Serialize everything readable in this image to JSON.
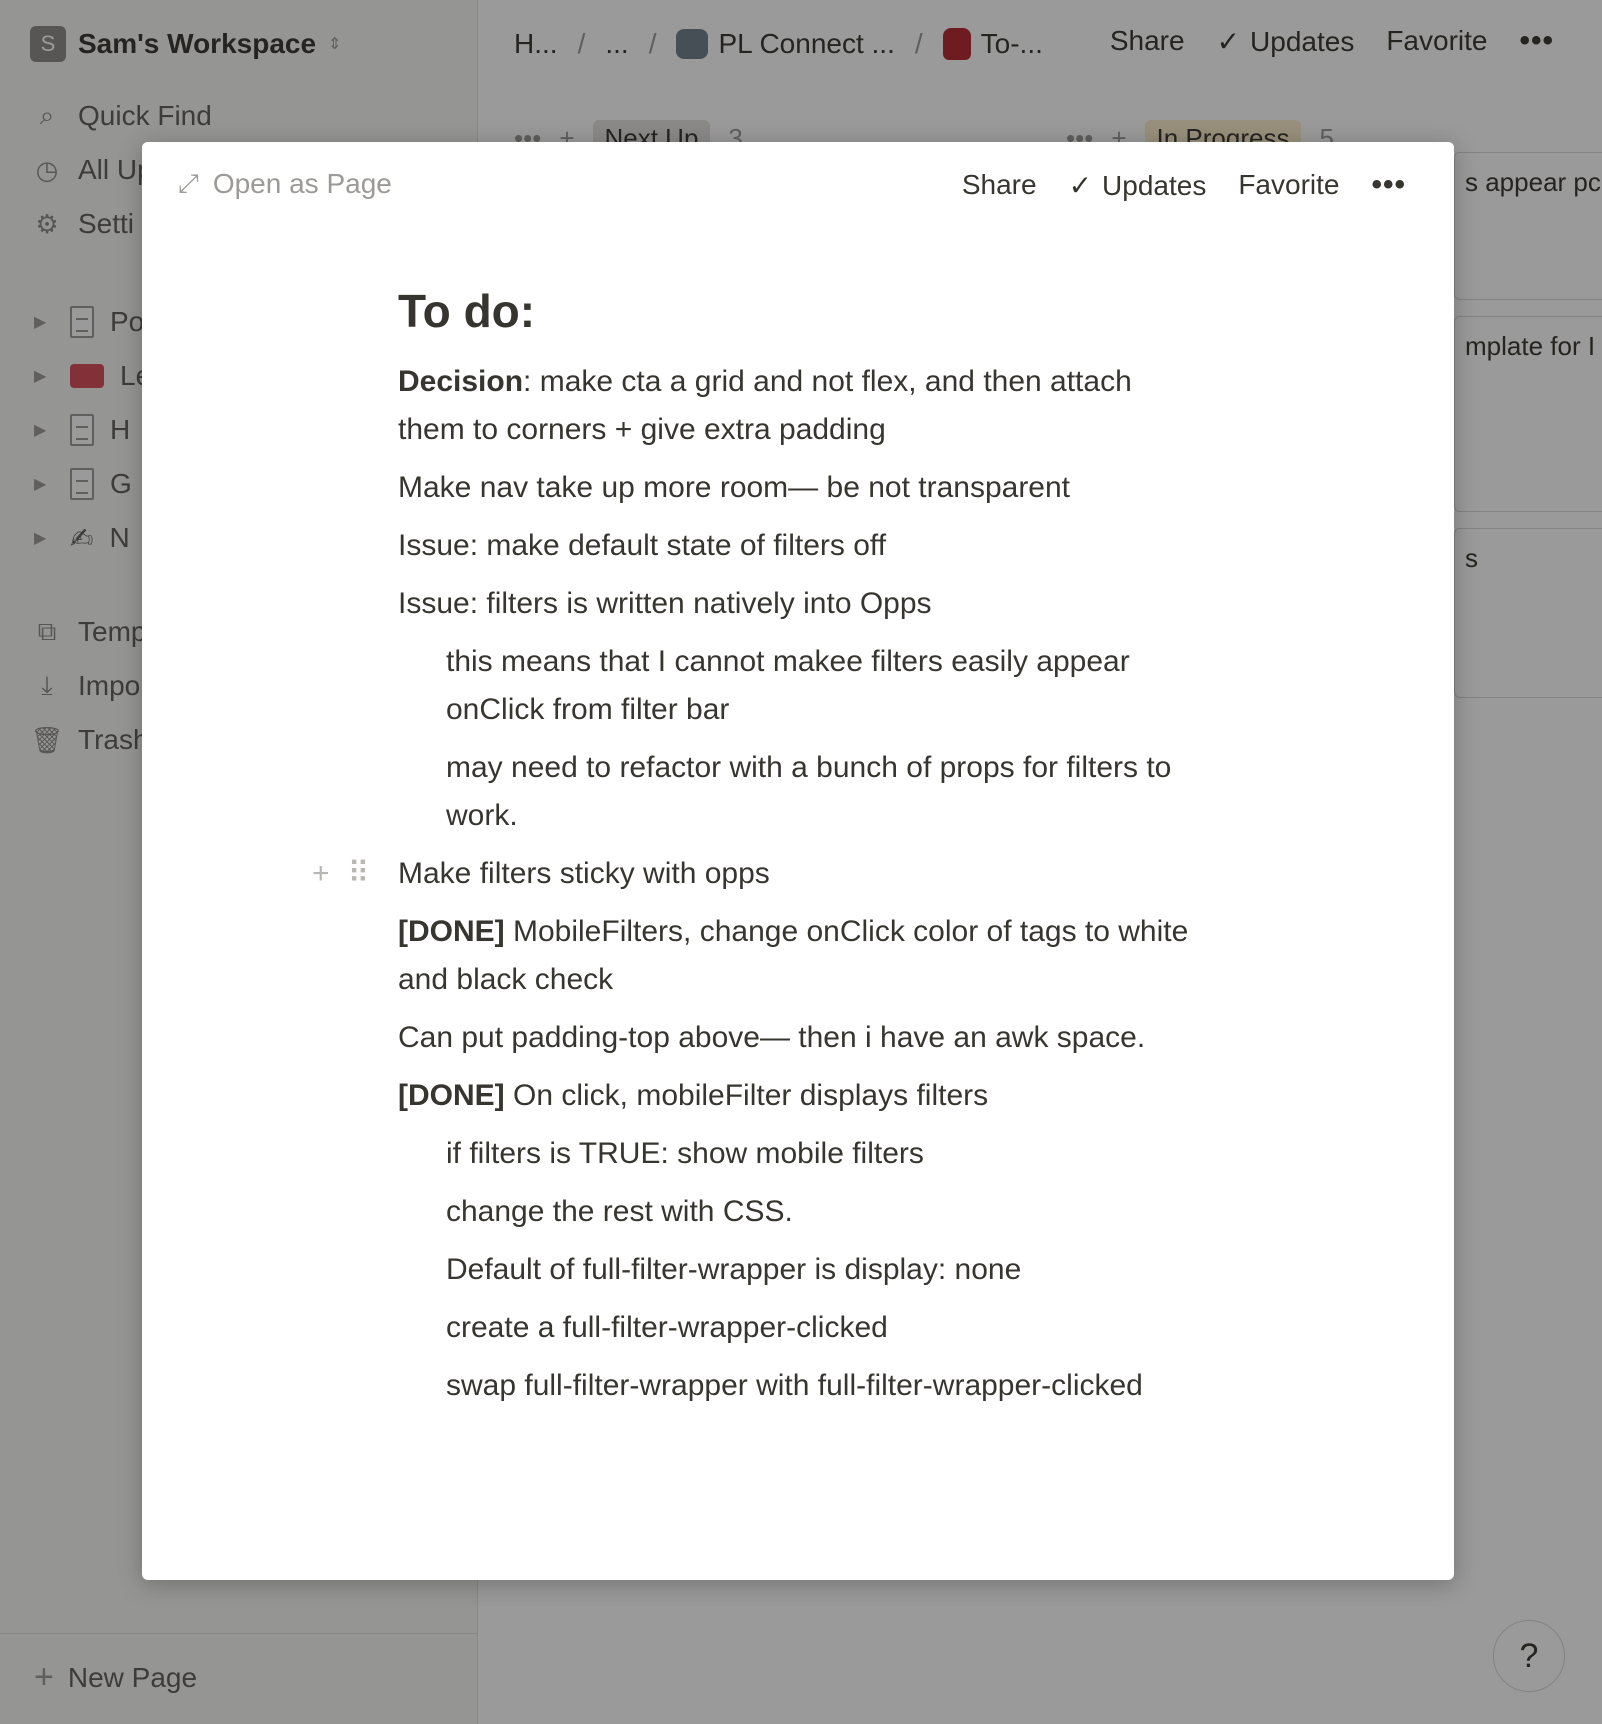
{
  "sidebar": {
    "workspace_initial": "S",
    "workspace_name": "Sam's Workspace",
    "workspace_chevron": "⇕",
    "items": [
      {
        "icon": "search-icon",
        "glyph": "⌕",
        "label": "Quick Find"
      },
      {
        "icon": "clock-icon",
        "glyph": "◷",
        "label": "All Up"
      },
      {
        "icon": "gear-icon",
        "glyph": "⚙",
        "label": "Setti"
      }
    ],
    "pages": [
      {
        "icon": "document-icon",
        "label": "Po"
      },
      {
        "icon": "ticket-icon",
        "label": "Le"
      },
      {
        "icon": "document-icon",
        "label": "H"
      },
      {
        "icon": "document-icon",
        "label": "G"
      },
      {
        "icon": "writing-hand-icon",
        "glyph": "✍",
        "label": "N"
      }
    ],
    "utilities": [
      {
        "icon": "templates-icon",
        "glyph": "⧉",
        "label": "Temp"
      },
      {
        "icon": "import-icon",
        "glyph": "⤓",
        "label": "Impo"
      },
      {
        "icon": "trash-icon",
        "glyph": "🗑",
        "label": "Trash"
      }
    ],
    "new_page_label": "New Page"
  },
  "topbar": {
    "crumbs": [
      "H...",
      "...",
      "PL Connect ...",
      "To-..."
    ],
    "separator": "/",
    "share": "Share",
    "updates": "Updates",
    "favorite": "Favorite",
    "more": "•••"
  },
  "board": {
    "columns": [
      {
        "name": "Next Up",
        "count": "3",
        "color": "gray"
      },
      {
        "name": "In Progress",
        "count": "5",
        "color": "yellow"
      }
    ],
    "card_snippets": [
      "s appear pc",
      "mplate for I",
      "s"
    ],
    "board_dots": "•••",
    "board_plus": "+"
  },
  "help_label": "?",
  "modal": {
    "open_as_page": "Open as Page",
    "share": "Share",
    "updates": "Updates",
    "favorite": "Favorite",
    "more": "•••",
    "heading": "To do:",
    "blocks": [
      {
        "bold": "Decision",
        "text": ": make cta a grid and not flex, and then attach them to corners + give extra padding",
        "indent": false
      },
      {
        "bold": "",
        "text": "Make nav take up more room— be not transparent",
        "indent": false
      },
      {
        "bold": "",
        "text": "Issue:  make default state of filters off",
        "indent": false
      },
      {
        "bold": "",
        "text": "Issue:  filters is written natively into Opps",
        "indent": false
      },
      {
        "bold": "",
        "text": "this means that I cannot makee filters easily appear onClick from filter bar",
        "indent": true
      },
      {
        "bold": "",
        "text": "may need to refactor with a bunch of props for filters to work.",
        "indent": true
      },
      {
        "bold": "",
        "text": "Make filters sticky with opps",
        "indent": false,
        "hover": true
      },
      {
        "bold": "[DONE]",
        "text": " MobileFilters, change onClick color of tags to white and black check",
        "indent": false
      },
      {
        "bold": "",
        "text": "Can put padding-top above— then i have an awk space.",
        "indent": false
      },
      {
        "bold": "[DONE]",
        "text": " On click, mobileFilter displays filters",
        "indent": false
      },
      {
        "bold": "",
        "text": "if filters is TRUE:  show mobile filters",
        "indent": true
      },
      {
        "bold": "",
        "text": "change the rest with CSS.",
        "indent": true
      },
      {
        "bold": "",
        "text": "Default of full-filter-wrapper is display: none",
        "indent": true
      },
      {
        "bold": "",
        "text": "create a full-filter-wrapper-clicked",
        "indent": true
      },
      {
        "bold": "",
        "text": "swap full-filter-wrapper with full-filter-wrapper-clicked",
        "indent": true
      }
    ]
  }
}
